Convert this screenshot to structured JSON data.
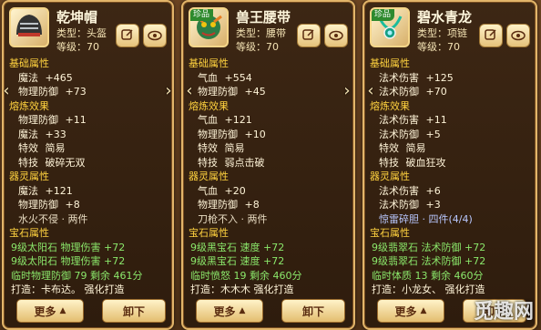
{
  "ui": {
    "btn_more": "更多",
    "btn_unequip": "卸下",
    "badge": "珍品",
    "sections": {
      "basic": "基础属性",
      "refine": "熔炼效果",
      "spirit": "器灵属性",
      "gem": "宝石属性"
    }
  },
  "items": [
    {
      "name": "乾坤帽",
      "type": "类型：头盔",
      "level": "等级：70",
      "has_badge": false,
      "basic": [
        {
          "label": "魔法",
          "value": "+465"
        },
        {
          "label": "物理防御",
          "value": "+73"
        }
      ],
      "refine": [
        {
          "label": "物理防御",
          "value": "+11"
        },
        {
          "label": "魔法",
          "value": "+33"
        },
        {
          "label": "特效",
          "value": "简易"
        },
        {
          "label": "特技",
          "value": "破碎无双"
        }
      ],
      "spirit": [
        {
          "label": "魔法",
          "value": "+121"
        },
        {
          "label": "物理防御",
          "value": "+8"
        }
      ],
      "set": "水火不侵 · 两件",
      "gems": [
        {
          "text": "9级太阳石",
          "attr": "物理伤害",
          "value": "+72"
        },
        {
          "text": "9级太阳石",
          "attr": "物理伤害",
          "value": "+72"
        }
      ],
      "temp": {
        "label": "临时物理防御",
        "value": "79",
        "remain": "剩余 461分"
      },
      "forge": {
        "label": "打造：",
        "by": "卡布达。",
        "strengthen": "强化打造"
      }
    },
    {
      "name": "兽王腰带",
      "type": "类型：腰带",
      "level": "等级：70",
      "has_badge": true,
      "basic": [
        {
          "label": "气血",
          "value": "+554"
        },
        {
          "label": "物理防御",
          "value": "+45"
        }
      ],
      "refine": [
        {
          "label": "气血",
          "value": "+121"
        },
        {
          "label": "物理防御",
          "value": "+10"
        },
        {
          "label": "特效",
          "value": "简易"
        },
        {
          "label": "特技",
          "value": "弱点击破"
        }
      ],
      "spirit": [
        {
          "label": "气血",
          "value": "+20"
        },
        {
          "label": "物理防御",
          "value": "+8"
        }
      ],
      "set": "刀枪不入 · 两件",
      "gems": [
        {
          "text": "9级黑宝石",
          "attr": "速度",
          "value": "+72"
        },
        {
          "text": "9级黑宝石",
          "attr": "速度",
          "value": "+72"
        }
      ],
      "temp": {
        "label": "临时愤怒",
        "value": "19",
        "remain": "剩余 460分"
      },
      "forge": {
        "label": "打造：",
        "by": "木木木",
        "strengthen": "强化打造"
      }
    },
    {
      "name": "碧水青龙",
      "type": "类型：项链",
      "level": "等级：70",
      "has_badge": true,
      "basic": [
        {
          "label": "法术伤害",
          "value": "+125"
        },
        {
          "label": "法术防御",
          "value": "+70"
        }
      ],
      "refine": [
        {
          "label": "法术伤害",
          "value": "+11"
        },
        {
          "label": "法术防御",
          "value": "+5"
        },
        {
          "label": "特效",
          "value": "简易"
        },
        {
          "label": "特技",
          "value": "破血狂攻"
        }
      ],
      "spirit": [
        {
          "label": "法术伤害",
          "value": "+6"
        },
        {
          "label": "法术防御",
          "value": "+3"
        }
      ],
      "set": "惊雷碎胆 · 四件(4/4)",
      "gems": [
        {
          "text": "9级翡翠石",
          "attr": "法术防御",
          "value": "+72"
        },
        {
          "text": "9级翡翠石",
          "attr": "法术防御",
          "value": "+72"
        }
      ],
      "temp": {
        "label": "临时体质",
        "value": "13",
        "remain": "剩余 460分"
      },
      "forge": {
        "label": "打造：",
        "by": "小龙女、",
        "strengthen": "强化打造"
      }
    }
  ],
  "watermark": "觅趣网",
  "colors": {
    "section": "#ffd23f",
    "gem": "#8be86b",
    "panel_border": "#e2b56a"
  }
}
